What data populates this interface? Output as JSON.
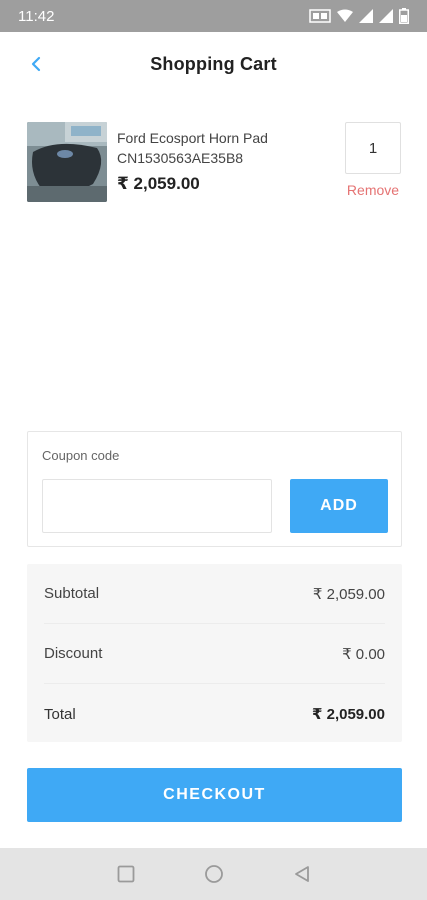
{
  "status_bar": {
    "time": "11:42"
  },
  "header": {
    "title": "Shopping Cart",
    "back_icon": "chevron-left-icon"
  },
  "cart": {
    "items": [
      {
        "name": "Ford Ecosport Horn Pad",
        "sku": "CN1530563AE35B8",
        "price": "₹ 2,059.00",
        "quantity": "1",
        "remove_label": "Remove"
      }
    ]
  },
  "coupon": {
    "label": "Coupon code",
    "value": "",
    "placeholder": "",
    "add_label": "ADD"
  },
  "summary": {
    "rows": [
      {
        "label": "Subtotal",
        "value": "₹ 2,059.00"
      },
      {
        "label": "Discount",
        "value": "₹ 0.00"
      },
      {
        "label": "Total",
        "value": "₹ 2,059.00"
      }
    ]
  },
  "checkout": {
    "label": "CHECKOUT"
  },
  "colors": {
    "accent": "#3fa9f5",
    "remove": "#e57373",
    "status_bar": "#9e9e9e"
  }
}
